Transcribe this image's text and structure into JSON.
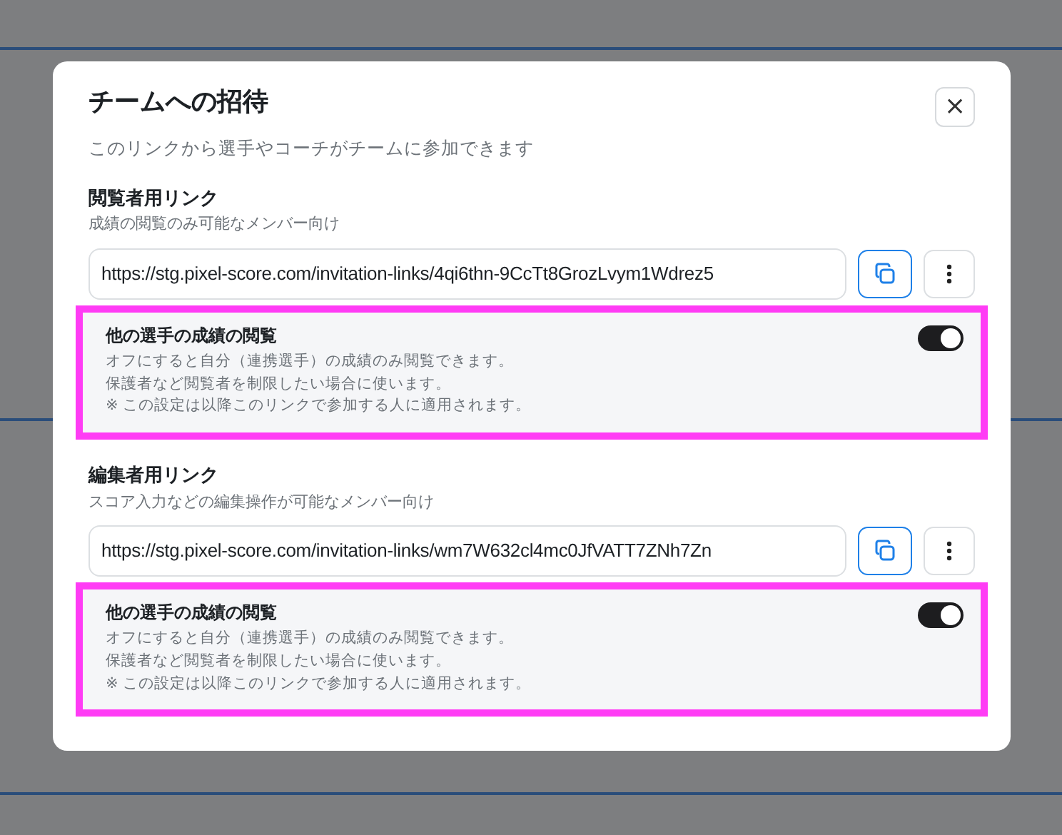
{
  "dialog": {
    "title": "チームへの招待",
    "subtitle": "このリンクから選手やコーチがチームに参加できます",
    "close": "×"
  },
  "links": [
    {
      "title": "閲覧者用リンク",
      "description": "成績の閲覧のみ可能なメンバー向け",
      "url": "https://stg.pixel-score.com/invitation-links/4qi6thn-9CcTt8GrozLvym1Wdrez5",
      "setting": {
        "title": "他の選手の成績の閲覧",
        "lines": [
          "オフにすると自分（連携選手）の成績のみ閲覧できます。",
          "保護者など閲覧者を制限したい場合に使います。",
          "※ この設定は以降このリンクで参加する人に適用されます。"
        ],
        "on": true,
        "highlighted": true
      }
    },
    {
      "title": "編集者用リンク",
      "description": "スコア入力などの編集操作が可能なメンバー向け",
      "url": "https://stg.pixel-score.com/invitation-links/wm7W632cl4mc0JfVATT7ZNh7Zn",
      "setting": {
        "title": "他の選手の成績の閲覧",
        "lines": [
          "オフにすると自分（連携選手）の成績のみ閲覧できます。",
          "保護者など閲覧者を制限したい場合に使います。",
          "※ この設定は以降このリンクで参加する人に適用されます。"
        ],
        "on": true,
        "highlighted": true
      }
    }
  ]
}
